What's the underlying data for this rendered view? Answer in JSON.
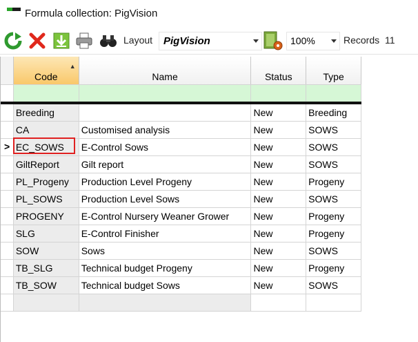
{
  "window": {
    "title": "Formula collection: PigVision"
  },
  "toolbar": {
    "layout_label": "Layout",
    "layout_value": "PigVision",
    "zoom_value": "100%",
    "records_label": "Records",
    "records_value": "11",
    "icons": [
      "refresh-icon",
      "delete-icon",
      "download-icon",
      "print-icon",
      "binoculars-icon",
      "layout-settings-icon"
    ]
  },
  "grid": {
    "columns": [
      "Code",
      "Name",
      "Status",
      "Type"
    ],
    "sorted_column": "Code",
    "selected_row": 2,
    "rows": [
      {
        "code": "Breeding",
        "name": "",
        "status": "New",
        "type": "Breeding"
      },
      {
        "code": "CA",
        "name": "Customised analysis",
        "status": "New",
        "type": "SOWS"
      },
      {
        "code": "EC_SOWS",
        "name": "E-Control Sows",
        "status": "New",
        "type": "SOWS"
      },
      {
        "code": "GiltReport",
        "name": "Gilt report",
        "status": "New",
        "type": "SOWS"
      },
      {
        "code": "PL_Progeny",
        "name": "Production Level Progeny",
        "status": "New",
        "type": "Progeny"
      },
      {
        "code": "PL_SOWS",
        "name": "Production Level Sows",
        "status": "New",
        "type": "SOWS"
      },
      {
        "code": "PROGENY",
        "name": "E-Control Nursery Weaner Grower",
        "status": "New",
        "type": "Progeny"
      },
      {
        "code": "SLG",
        "name": "E-Control Finisher",
        "status": "New",
        "type": "Progeny"
      },
      {
        "code": "SOW",
        "name": "Sows",
        "status": "New",
        "type": "SOWS"
      },
      {
        "code": "TB_SLG",
        "name": "Technical budget Progeny",
        "status": "New",
        "type": "Progeny"
      },
      {
        "code": "TB_SOW",
        "name": "Technical budget Sows",
        "status": "New",
        "type": "SOWS"
      }
    ]
  },
  "colors": {
    "selection": "#e02020",
    "filter_row": "#d6f7d6",
    "sorted_header": "#f9c86a"
  }
}
